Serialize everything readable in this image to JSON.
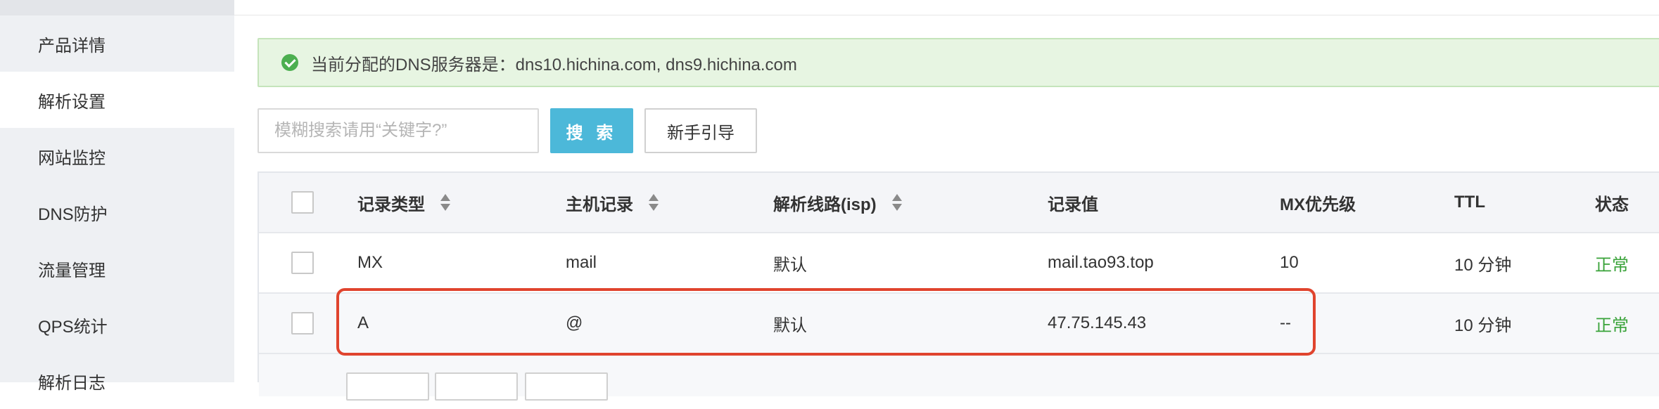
{
  "sidebar": {
    "items": [
      {
        "label": "产品详情",
        "active": false
      },
      {
        "label": "解析设置",
        "active": true
      },
      {
        "label": "网站监控",
        "active": false
      },
      {
        "label": "DNS防护",
        "active": false
      },
      {
        "label": "流量管理",
        "active": false
      },
      {
        "label": "QPS统计",
        "active": false
      },
      {
        "label": "解析日志",
        "active": false
      }
    ]
  },
  "alert": {
    "icon": "check-circle-icon",
    "text": "当前分配的DNS服务器是：dns10.hichina.com, dns9.hichina.com"
  },
  "search": {
    "placeholder": "模糊搜索请用“关键字?”",
    "value": "",
    "button_label": "搜 索",
    "guide_label": "新手引导"
  },
  "table": {
    "columns": [
      "记录类型",
      "主机记录",
      "解析线路(isp)",
      "记录值",
      "MX优先级",
      "TTL",
      "状态"
    ],
    "rows": [
      {
        "type": "MX",
        "host": "mail",
        "line": "默认",
        "value": "mail.tao93.top",
        "mx": "10",
        "ttl": "10 分钟",
        "status": "正常"
      },
      {
        "type": "A",
        "host": "@",
        "line": "默认",
        "value": "47.75.145.43",
        "mx": "--",
        "ttl": "10 分钟",
        "status": "正常"
      }
    ]
  },
  "colors": {
    "accent": "#4cb8d9",
    "status_ok": "#3aa33a",
    "highlight": "#e0442e",
    "alert_bg": "#e7f5e2"
  }
}
